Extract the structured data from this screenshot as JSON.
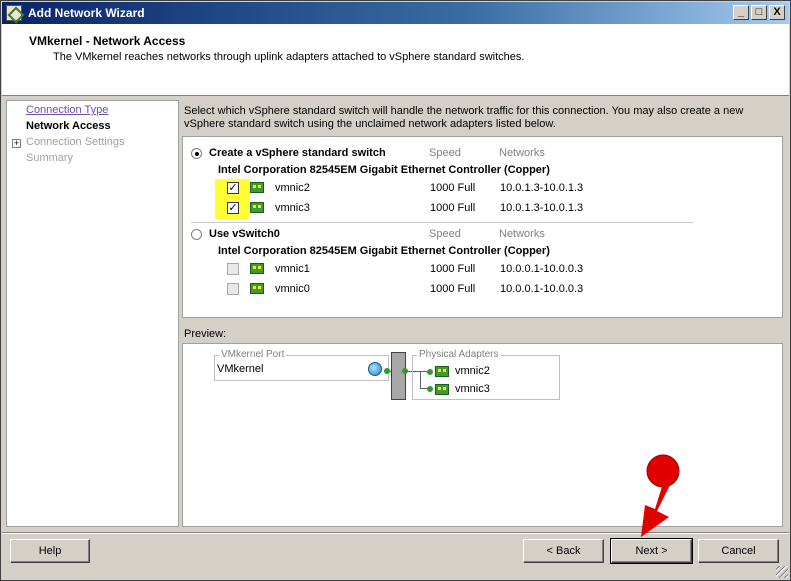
{
  "window": {
    "title": "Add Network Wizard",
    "buttons": {
      "minimize": "_",
      "maximize": "□",
      "close": "X"
    }
  },
  "header": {
    "title": "VMkernel - Network Access",
    "description": "The VMkernel reaches networks through uplink adapters attached to vSphere standard switches."
  },
  "nav": {
    "items": [
      {
        "label": "Connection Type",
        "state": "link"
      },
      {
        "label": "Network Access",
        "state": "current"
      },
      {
        "label": "Connection Settings",
        "state": "disabled",
        "expandable": true,
        "expand_glyph": "+"
      },
      {
        "label": "Summary",
        "state": "disabled"
      }
    ]
  },
  "instruction": "Select which vSphere standard switch will handle the network traffic for this connection. You may also create a new vSphere standard switch using the unclaimed network adapters listed below.",
  "options": {
    "create": {
      "label": "Create a vSphere standard switch",
      "selected": true,
      "col_speed": "Speed",
      "col_networks": "Networks",
      "controller": "Intel Corporation 82545EM Gigabit Ethernet Controller (Copper)",
      "adapters": [
        {
          "name": "vmnic2",
          "checked": true,
          "check_glyph": "✓",
          "speed": "1000 Full",
          "networks": "10.0.1.3-10.0.1.3"
        },
        {
          "name": "vmnic3",
          "checked": true,
          "check_glyph": "✓",
          "speed": "1000 Full",
          "networks": "10.0.1.3-10.0.1.3"
        }
      ]
    },
    "existing": {
      "label": "Use vSwitch0",
      "selected": false,
      "col_speed": "Speed",
      "col_networks": "Networks",
      "controller": "Intel Corporation 82545EM Gigabit Ethernet Controller (Copper)",
      "adapters": [
        {
          "name": "vmnic1",
          "checked": false,
          "disabled": true,
          "speed": "1000 Full",
          "networks": "10.0.0.1-10.0.0.3"
        },
        {
          "name": "vmnic0",
          "checked": false,
          "disabled": true,
          "speed": "1000 Full",
          "networks": "10.0.0.1-10.0.0.3"
        }
      ]
    }
  },
  "preview": {
    "label": "Preview:",
    "port_group_caption": "VMkernel Port",
    "port_name": "VMkernel",
    "adapters_caption": "Physical Adapters",
    "adapters": [
      "vmnic2",
      "vmnic3"
    ]
  },
  "footer": {
    "help": "Help",
    "back": "< Back",
    "next": "Next >",
    "cancel": "Cancel"
  },
  "annotation": {
    "color": "#ff0000",
    "icon": "red-pointer-arrow"
  },
  "colors": {
    "highlight": "#ffff33",
    "titlebar": "#0a246a",
    "link": "#6a4ea8"
  }
}
